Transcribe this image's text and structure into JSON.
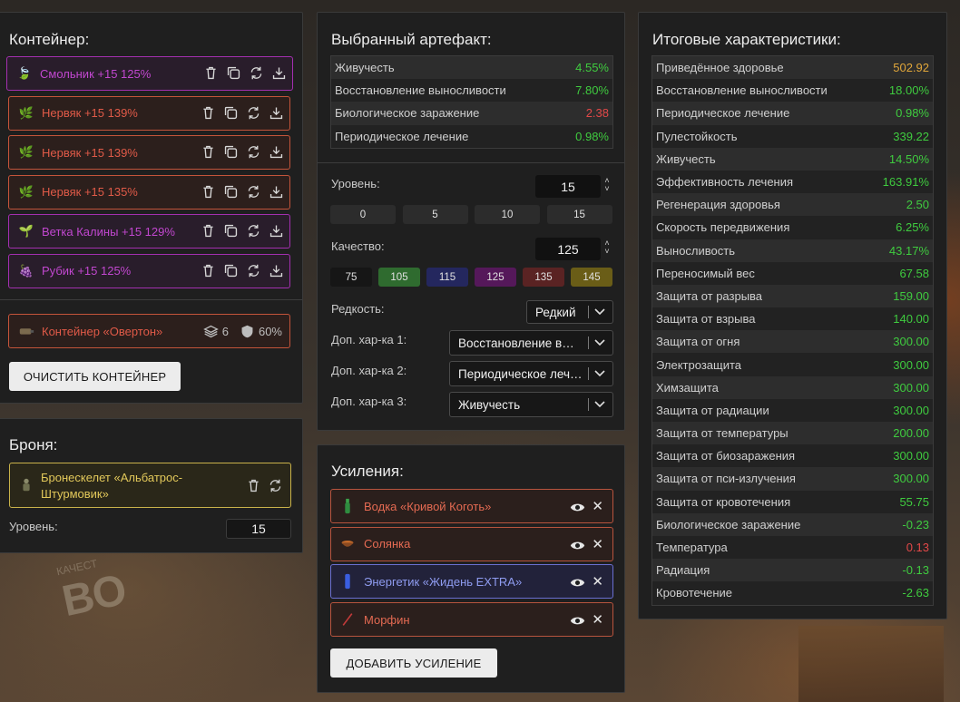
{
  "container": {
    "title": "Контейнер:",
    "items": [
      {
        "label": "Смольник +15 125%",
        "style": "purple",
        "glyph": "🍃"
      },
      {
        "label": "Нервяк +15 139%",
        "style": "orange",
        "glyph": "🌿"
      },
      {
        "label": "Нервяк +15 139%",
        "style": "orange",
        "glyph": "🌿"
      },
      {
        "label": "Нервяк +15 135%",
        "style": "orange",
        "glyph": "🌿"
      },
      {
        "label": "Ветка Калины +15 129%",
        "style": "purple",
        "glyph": "🌱"
      },
      {
        "label": "Рубик +15 125%",
        "style": "purple",
        "glyph": "🍇"
      }
    ],
    "case": {
      "label": "Контейнер «Овертон»",
      "slots": "6",
      "protection": "60%"
    },
    "clear_button": "ОЧИСТИТЬ КОНТЕЙНЕР"
  },
  "armor": {
    "title": "Броня:",
    "item_label": "Бронескелет «Альбатрос-Штурмовик»",
    "level_label": "Уровень:",
    "level_value": "15"
  },
  "artifact": {
    "title": "Выбранный артефакт:",
    "stats": [
      {
        "name": "Живучесть",
        "value": "4.55%",
        "color": "g"
      },
      {
        "name": "Восстановление выносливости",
        "value": "7.80%",
        "color": "g"
      },
      {
        "name": "Биологическое заражение",
        "value": "2.38",
        "color": "r"
      },
      {
        "name": "Периодическое лечение",
        "value": "0.98%",
        "color": "g"
      }
    ],
    "level_label": "Уровень:",
    "level_value": "15",
    "level_presets": [
      "0",
      "5",
      "10",
      "15"
    ],
    "quality_label": "Качество:",
    "quality_value": "125",
    "quality_presets": [
      {
        "label": "75",
        "color": "#161616"
      },
      {
        "label": "105",
        "color": "#2f6b2f"
      },
      {
        "label": "115",
        "color": "#24275e"
      },
      {
        "label": "125",
        "color": "#55185a"
      },
      {
        "label": "135",
        "color": "#5a2323"
      },
      {
        "label": "145",
        "color": "#6a5d17"
      }
    ],
    "rarity_label": "Редкость:",
    "rarity_value": "Редкий",
    "extra1_label": "Доп. хар-ка 1:",
    "extra1_value": "Восстановление выносливости",
    "extra2_label": "Доп. хар-ка 2:",
    "extra2_value": "Периодическое лечение",
    "extra3_label": "Доп. хар-ка 3:",
    "extra3_value": "Живучесть"
  },
  "boosts": {
    "title": "Усиления:",
    "items": [
      {
        "label": "Водка «Кривой Коготь»",
        "style": "red"
      },
      {
        "label": "Солянка",
        "style": "red"
      },
      {
        "label": "Энергетик «Жидень EXTRA»",
        "style": "blue"
      },
      {
        "label": "Морфин",
        "style": "red"
      }
    ],
    "add_button": "ДОБАВИТЬ УСИЛЕНИЕ"
  },
  "totals": {
    "title": "Итоговые характеристики:",
    "stats": [
      {
        "name": "Приведённое здоровье",
        "value": "502.92",
        "color": "o"
      },
      {
        "name": "Восстановление выносливости",
        "value": "18.00%",
        "color": "g"
      },
      {
        "name": "Периодическое лечение",
        "value": "0.98%",
        "color": "g"
      },
      {
        "name": "Пулестойкость",
        "value": "339.22",
        "color": "g"
      },
      {
        "name": "Живучесть",
        "value": "14.50%",
        "color": "g"
      },
      {
        "name": "Эффективность лечения",
        "value": "163.91%",
        "color": "g"
      },
      {
        "name": "Регенерация здоровья",
        "value": "2.50",
        "color": "g"
      },
      {
        "name": "Скорость передвижения",
        "value": "6.25%",
        "color": "g"
      },
      {
        "name": "Выносливость",
        "value": "43.17%",
        "color": "g"
      },
      {
        "name": "Переносимый вес",
        "value": "67.58",
        "color": "g"
      },
      {
        "name": "Защита от разрыва",
        "value": "159.00",
        "color": "g"
      },
      {
        "name": "Защита от взрыва",
        "value": "140.00",
        "color": "g"
      },
      {
        "name": "Защита от огня",
        "value": "300.00",
        "color": "g"
      },
      {
        "name": "Электрозащита",
        "value": "300.00",
        "color": "g"
      },
      {
        "name": "Химзащита",
        "value": "300.00",
        "color": "g"
      },
      {
        "name": "Защита от радиации",
        "value": "300.00",
        "color": "g"
      },
      {
        "name": "Защита от температуры",
        "value": "200.00",
        "color": "g"
      },
      {
        "name": "Защита от биозаражения",
        "value": "300.00",
        "color": "g"
      },
      {
        "name": "Защита от пси-излучения",
        "value": "300.00",
        "color": "g"
      },
      {
        "name": "Защита от кровотечения",
        "value": "55.75",
        "color": "g"
      },
      {
        "name": "Биологическое заражение",
        "value": "-0.23",
        "color": "g"
      },
      {
        "name": "Температура",
        "value": "0.13",
        "color": "r"
      },
      {
        "name": "Радиация",
        "value": "-0.13",
        "color": "g"
      },
      {
        "name": "Кровотечение",
        "value": "-2.63",
        "color": "g"
      }
    ]
  },
  "background_text": {
    "sign_small": "КАЧЕСТ",
    "sign_big": "ВО"
  }
}
